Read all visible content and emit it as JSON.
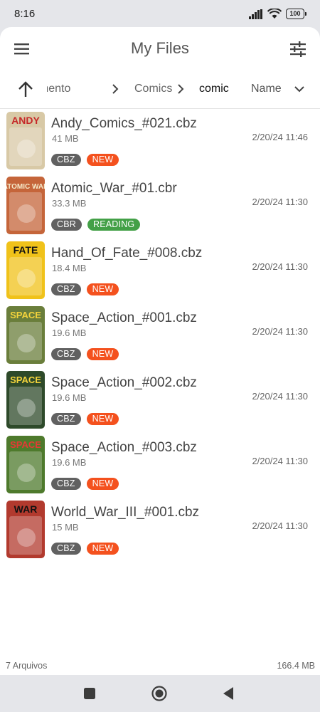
{
  "status": {
    "time": "8:16",
    "battery": "100"
  },
  "appbar": {
    "title": "My Files",
    "menu_icon": "hamburger-menu-icon",
    "filter_icon": "tune-sliders-icon"
  },
  "breadcrumbs": {
    "up_icon": "arrow-up-icon",
    "items": [
      {
        "label": "Armazenamento"
      },
      {
        "label": "Comics"
      },
      {
        "label": "comic"
      }
    ],
    "sort_label": "Name"
  },
  "files": [
    {
      "name": "Andy_Comics_#021.cbz",
      "size": "41 MB",
      "date": "2/20/24 11:46",
      "type": "CBZ",
      "status": "NEW",
      "status_color": "#f4511e",
      "cover_bg": "#d8c9a6",
      "cover_title": "ANDY",
      "cover_title_color": "#c62828"
    },
    {
      "name": "Atomic_War_#01.cbr",
      "size": "33.3 MB",
      "date": "2/20/24 11:30",
      "type": "CBR",
      "status": "READING",
      "status_color": "#43a047",
      "cover_bg": "#c5653a",
      "cover_title": "ATOMIC WAR",
      "cover_title_color": "#f5e9c9"
    },
    {
      "name": "Hand_Of_Fate_#008.cbz",
      "size": "18.4 MB",
      "date": "2/20/24 11:30",
      "type": "CBZ",
      "status": "NEW",
      "status_color": "#f4511e",
      "cover_bg": "#f0c21a",
      "cover_title": "FATE",
      "cover_title_color": "#111111"
    },
    {
      "name": "Space_Action_#001.cbz",
      "size": "19.6 MB",
      "date": "2/20/24 11:30",
      "type": "CBZ",
      "status": "NEW",
      "status_color": "#f4511e",
      "cover_bg": "#6a7e3b",
      "cover_title": "SPACE",
      "cover_title_color": "#f3d33c"
    },
    {
      "name": "Space_Action_#002.cbz",
      "size": "19.6 MB",
      "date": "2/20/24 11:30",
      "type": "CBZ",
      "status": "NEW",
      "status_color": "#f4511e",
      "cover_bg": "#2e4a2a",
      "cover_title": "SPACE",
      "cover_title_color": "#f3d33c"
    },
    {
      "name": "Space_Action_#003.cbz",
      "size": "19.6 MB",
      "date": "2/20/24 11:30",
      "type": "CBZ",
      "status": "NEW",
      "status_color": "#f4511e",
      "cover_bg": "#4e7a2c",
      "cover_title": "SPACE",
      "cover_title_color": "#e53935"
    },
    {
      "name": "World_War_III_#001.cbz",
      "size": "15 MB",
      "date": "2/20/24 11:30",
      "type": "CBZ",
      "status": "NEW",
      "status_color": "#f4511e",
      "cover_bg": "#b23a2e",
      "cover_title": "WAR",
      "cover_title_color": "#111111"
    }
  ],
  "footer": {
    "count": "7 Arquivos",
    "total": "166.4 MB"
  },
  "navbar": {
    "recents_icon": "square-recents-icon",
    "home_icon": "circle-home-icon",
    "back_icon": "triangle-back-icon"
  }
}
